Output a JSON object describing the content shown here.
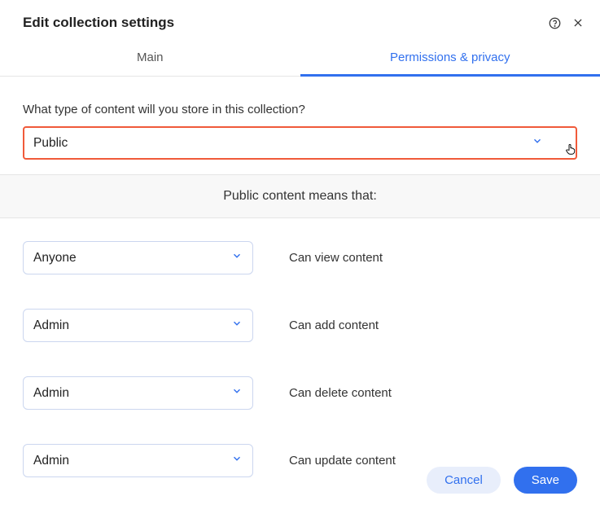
{
  "header": {
    "title": "Edit collection settings"
  },
  "tabs": {
    "main": "Main",
    "permissions": "Permissions & privacy"
  },
  "question": "What type of content will you store in this collection?",
  "content_type_value": "Public",
  "banner": "Public content means that:",
  "permissions": [
    {
      "value": "Anyone",
      "label": "Can view content"
    },
    {
      "value": "Admin",
      "label": "Can add content"
    },
    {
      "value": "Admin",
      "label": "Can delete content"
    },
    {
      "value": "Admin",
      "label": "Can update content"
    }
  ],
  "footer": {
    "cancel": "Cancel",
    "save": "Save"
  }
}
